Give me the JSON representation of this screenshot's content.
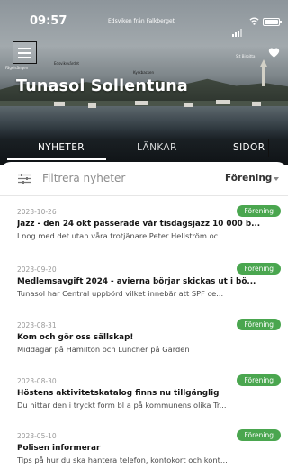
{
  "status_bar": {
    "time": "09:57",
    "window_title": "Edsviken från Falkberget"
  },
  "hero": {
    "title": "Tunasol Sollentuna",
    "photo_labels": {
      "left": "Fågelsången",
      "left_middle": "Edsviksvärdet",
      "middle": "Kyrkbacken",
      "right": "S:t Birgitta"
    }
  },
  "tabs": [
    {
      "label": "NYHETER",
      "active": true
    },
    {
      "label": "LÄNKAR",
      "active": false
    },
    {
      "label": "SIDOR",
      "active": false
    }
  ],
  "filter": {
    "placeholder": "Filtrera nyheter",
    "selected": "Förening"
  },
  "news": [
    {
      "date": "2023-10-26",
      "badge": "Förening",
      "title": "Jazz - den 24 okt passerade vår tisdagsjazz 10 000 b...",
      "snippet": "I nog med det utan våra trotjänare Peter Hellström oc..."
    },
    {
      "date": "2023-09-20",
      "badge": "Förening",
      "title": "Medlemsavgift 2024 - avierna börjar skickas ut i bö...",
      "snippet": "Tunasol har Central uppbörd vilket innebär att SPF ce..."
    },
    {
      "date": "2023-08-31",
      "badge": "Förening",
      "title": "Kom och gör oss sällskap!",
      "snippet": "Middagar på Hamilton och Luncher på Garden"
    },
    {
      "date": "2023-08-30",
      "badge": "Förening",
      "title": "Höstens aktivitetskatalog finns nu tillgänglig",
      "snippet": "Du hittar den i tryckt form bl a på kommunens olika Tr..."
    },
    {
      "date": "2023-05-10",
      "badge": "Förening",
      "title": "Polisen informerar",
      "snippet": "Tips på hur du ska hantera telefon, kontokort och kont..."
    }
  ],
  "colors": {
    "badge": "#4aa64f",
    "tab_text": "#ffffff",
    "header_dark": "#12171a"
  },
  "icons": {
    "menu": "hamburger-icon",
    "favorite": "heart-icon",
    "filter": "sliders-icon",
    "dropdown": "chevron-down-icon"
  }
}
